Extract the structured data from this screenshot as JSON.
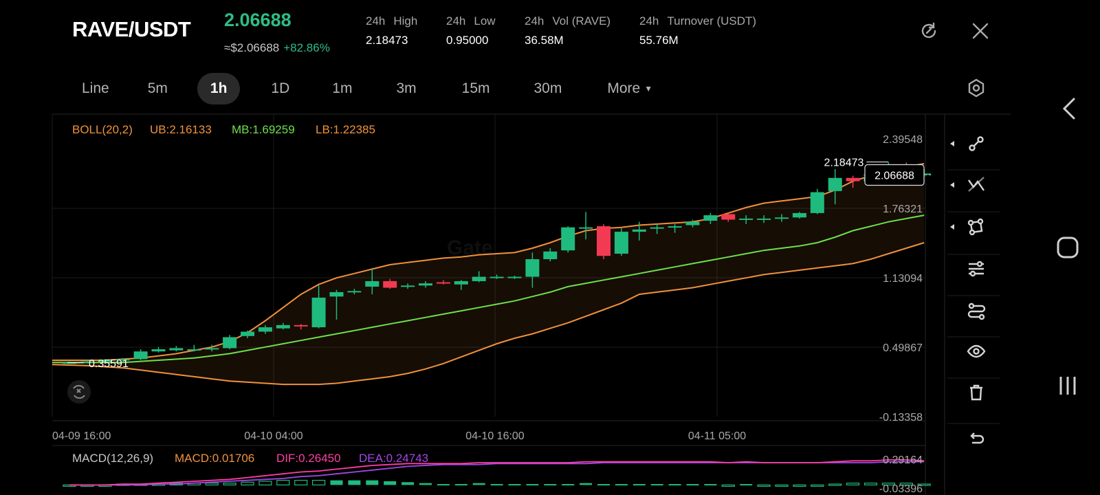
{
  "header": {
    "pair": "RAVE/USDT",
    "price": "2.06688",
    "usd_price": "≈$2.06688",
    "change": "+82.86%",
    "stats": [
      {
        "period": "24h",
        "label": "High",
        "value": "2.18473"
      },
      {
        "period": "24h",
        "label": "Low",
        "value": "0.95000"
      },
      {
        "period": "24h",
        "label": "Vol (RAVE)",
        "value": "36.58M"
      },
      {
        "period": "24h",
        "label": "Turnover (USDT)",
        "value": "55.76M"
      }
    ],
    "icons": {
      "refresh": "refresh-icon",
      "close": "close-icon"
    }
  },
  "tabs": [
    {
      "label": "Line",
      "active": false
    },
    {
      "label": "5m",
      "active": false
    },
    {
      "label": "1h",
      "active": true
    },
    {
      "label": "1D",
      "active": false
    },
    {
      "label": "1m",
      "active": false
    },
    {
      "label": "3m",
      "active": false
    },
    {
      "label": "15m",
      "active": false
    },
    {
      "label": "30m",
      "active": false
    },
    {
      "label": "More",
      "active": false
    }
  ],
  "boll": {
    "label": "BOLL(20,2)",
    "ub": "UB:2.16133",
    "mb": "MB:1.69259",
    "lb": "LB:1.22385"
  },
  "macd": {
    "label": "MACD(12,26,9)",
    "macd": "MACD:0.01706",
    "dif": "DIF:0.26450",
    "dea": "DEA:0.24743"
  },
  "price_axis": [
    "2.39548",
    "1.76321",
    "1.13094",
    "0.49867",
    "-0.13358"
  ],
  "macd_axis": [
    "0.29164",
    "-0.03396"
  ],
  "time_axis": [
    "04-09 16:00",
    "04-10 04:00",
    "04-10 16:00",
    "04-11 05:00"
  ],
  "annotations": {
    "high": "2.18473",
    "low": "0.35591",
    "last": "2.06688"
  },
  "colors": {
    "up": "#1fba7e",
    "down": "#f23a52",
    "ub": "#f0923c",
    "mb": "#6ee04a",
    "lb": "#f0923c",
    "dif": "#ff3fa4",
    "dea": "#a347e8",
    "boll_label": "#f0923c"
  },
  "chart_data": {
    "type": "candlestick",
    "candles": [
      {
        "o": 0.36,
        "c": 0.36,
        "h": 0.37,
        "l": 0.35
      },
      {
        "o": 0.36,
        "c": 0.37,
        "h": 0.38,
        "l": 0.35
      },
      {
        "o": 0.37,
        "c": 0.38,
        "h": 0.39,
        "l": 0.36
      },
      {
        "o": 0.38,
        "c": 0.39,
        "h": 0.4,
        "l": 0.37
      },
      {
        "o": 0.39,
        "c": 0.46,
        "h": 0.48,
        "l": 0.38
      },
      {
        "o": 0.46,
        "c": 0.48,
        "h": 0.5,
        "l": 0.45
      },
      {
        "o": 0.47,
        "c": 0.49,
        "h": 0.51,
        "l": 0.46
      },
      {
        "o": 0.48,
        "c": 0.48,
        "h": 0.52,
        "l": 0.46
      },
      {
        "o": 0.48,
        "c": 0.49,
        "h": 0.52,
        "l": 0.46
      },
      {
        "o": 0.49,
        "c": 0.59,
        "h": 0.61,
        "l": 0.48
      },
      {
        "o": 0.6,
        "c": 0.64,
        "h": 0.65,
        "l": 0.58
      },
      {
        "o": 0.64,
        "c": 0.68,
        "h": 0.7,
        "l": 0.62
      },
      {
        "o": 0.67,
        "c": 0.7,
        "h": 0.72,
        "l": 0.66
      },
      {
        "o": 0.7,
        "c": 0.69,
        "h": 0.71,
        "l": 0.66
      },
      {
        "o": 0.68,
        "c": 0.95,
        "h": 1.06,
        "l": 0.67
      },
      {
        "o": 0.96,
        "c": 1.0,
        "h": 1.02,
        "l": 0.75
      },
      {
        "o": 1.0,
        "c": 1.01,
        "h": 1.03,
        "l": 0.98
      },
      {
        "o": 1.05,
        "c": 1.1,
        "h": 1.22,
        "l": 0.98
      },
      {
        "o": 1.1,
        "c": 1.04,
        "h": 1.12,
        "l": 1.03
      },
      {
        "o": 1.05,
        "c": 1.06,
        "h": 1.08,
        "l": 1.03
      },
      {
        "o": 1.06,
        "c": 1.08,
        "h": 1.1,
        "l": 1.04
      },
      {
        "o": 1.09,
        "c": 1.08,
        "h": 1.11,
        "l": 1.07
      },
      {
        "o": 1.07,
        "c": 1.1,
        "h": 1.11,
        "l": 1.02
      },
      {
        "o": 1.1,
        "c": 1.14,
        "h": 1.19,
        "l": 1.09
      },
      {
        "o": 1.14,
        "c": 1.14,
        "h": 1.16,
        "l": 1.12
      },
      {
        "o": 1.13,
        "c": 1.14,
        "h": 1.15,
        "l": 1.12
      },
      {
        "o": 1.14,
        "c": 1.3,
        "h": 1.36,
        "l": 1.04
      },
      {
        "o": 1.3,
        "c": 1.37,
        "h": 1.4,
        "l": 1.28
      },
      {
        "o": 1.38,
        "c": 1.59,
        "h": 1.6,
        "l": 1.36
      },
      {
        "o": 1.58,
        "c": 1.59,
        "h": 1.73,
        "l": 1.48
      },
      {
        "o": 1.6,
        "c": 1.33,
        "h": 1.62,
        "l": 1.3
      },
      {
        "o": 1.35,
        "c": 1.55,
        "h": 1.58,
        "l": 1.33
      },
      {
        "o": 1.55,
        "c": 1.57,
        "h": 1.64,
        "l": 1.47
      },
      {
        "o": 1.58,
        "c": 1.59,
        "h": 1.62,
        "l": 1.53
      },
      {
        "o": 1.59,
        "c": 1.6,
        "h": 1.62,
        "l": 1.54
      },
      {
        "o": 1.61,
        "c": 1.64,
        "h": 1.66,
        "l": 1.59
      },
      {
        "o": 1.65,
        "c": 1.7,
        "h": 1.72,
        "l": 1.62
      },
      {
        "o": 1.71,
        "c": 1.66,
        "h": 1.72,
        "l": 1.64
      },
      {
        "o": 1.66,
        "c": 1.67,
        "h": 1.7,
        "l": 1.62
      },
      {
        "o": 1.67,
        "c": 1.67,
        "h": 1.7,
        "l": 1.63
      },
      {
        "o": 1.67,
        "c": 1.68,
        "h": 1.71,
        "l": 1.64
      },
      {
        "o": 1.68,
        "c": 1.72,
        "h": 1.73,
        "l": 1.67
      },
      {
        "o": 1.72,
        "c": 1.91,
        "h": 1.94,
        "l": 1.71
      },
      {
        "o": 1.92,
        "c": 2.04,
        "h": 2.12,
        "l": 1.8
      },
      {
        "o": 2.04,
        "c": 2.01,
        "h": 2.06,
        "l": 1.95
      },
      {
        "o": 2.01,
        "c": 2.05,
        "h": 2.06,
        "l": 1.98
      },
      {
        "o": 2.05,
        "c": 2.16,
        "h": 2.18,
        "l": 2.04
      },
      {
        "o": 2.16,
        "c": 2.12,
        "h": 2.18,
        "l": 2.07
      },
      {
        "o": 2.08,
        "c": 2.08,
        "h": 2.12,
        "l": 2.05
      }
    ],
    "ub": [
      0.38,
      0.38,
      0.38,
      0.39,
      0.4,
      0.42,
      0.44,
      0.47,
      0.5,
      0.55,
      0.63,
      0.74,
      0.86,
      0.98,
      1.07,
      1.13,
      1.17,
      1.21,
      1.25,
      1.27,
      1.29,
      1.31,
      1.32,
      1.34,
      1.35,
      1.36,
      1.4,
      1.45,
      1.51,
      1.56,
      1.58,
      1.59,
      1.61,
      1.62,
      1.63,
      1.64,
      1.67,
      1.72,
      1.77,
      1.81,
      1.83,
      1.85,
      1.87,
      1.93,
      2.01,
      2.06,
      2.12,
      2.14,
      2.17
    ],
    "mb": [
      0.36,
      0.36,
      0.36,
      0.36,
      0.37,
      0.38,
      0.39,
      0.4,
      0.42,
      0.44,
      0.47,
      0.5,
      0.53,
      0.56,
      0.59,
      0.62,
      0.65,
      0.68,
      0.71,
      0.74,
      0.77,
      0.8,
      0.83,
      0.86,
      0.89,
      0.92,
      0.96,
      1.0,
      1.05,
      1.08,
      1.11,
      1.14,
      1.17,
      1.2,
      1.23,
      1.26,
      1.29,
      1.32,
      1.35,
      1.38,
      1.4,
      1.42,
      1.45,
      1.5,
      1.56,
      1.6,
      1.64,
      1.67,
      1.7
    ],
    "lb": [
      0.34,
      0.33,
      0.32,
      0.31,
      0.29,
      0.27,
      0.25,
      0.23,
      0.21,
      0.19,
      0.18,
      0.17,
      0.16,
      0.16,
      0.16,
      0.17,
      0.19,
      0.21,
      0.23,
      0.26,
      0.3,
      0.35,
      0.41,
      0.47,
      0.53,
      0.58,
      0.62,
      0.67,
      0.72,
      0.78,
      0.84,
      0.9,
      0.98,
      1.0,
      1.02,
      1.04,
      1.07,
      1.1,
      1.13,
      1.16,
      1.18,
      1.2,
      1.22,
      1.24,
      1.26,
      1.3,
      1.35,
      1.4,
      1.45
    ],
    "dif": [
      0.0,
      0.0,
      0.0,
      0.01,
      0.01,
      0.02,
      0.03,
      0.04,
      0.05,
      0.06,
      0.08,
      0.1,
      0.12,
      0.14,
      0.15,
      0.17,
      0.19,
      0.21,
      0.22,
      0.23,
      0.23,
      0.23,
      0.23,
      0.24,
      0.24,
      0.24,
      0.24,
      0.24,
      0.24,
      0.25,
      0.25,
      0.25,
      0.25,
      0.25,
      0.25,
      0.25,
      0.25,
      0.24,
      0.25,
      0.24,
      0.24,
      0.24,
      0.24,
      0.25,
      0.26,
      0.26,
      0.27,
      0.27,
      0.26
    ],
    "dea": [
      0.0,
      0.0,
      0.0,
      0.0,
      0.0,
      0.01,
      0.01,
      0.02,
      0.03,
      0.04,
      0.05,
      0.06,
      0.07,
      0.09,
      0.1,
      0.12,
      0.14,
      0.16,
      0.18,
      0.2,
      0.21,
      0.22,
      0.22,
      0.22,
      0.23,
      0.23,
      0.23,
      0.23,
      0.23,
      0.23,
      0.24,
      0.24,
      0.24,
      0.24,
      0.24,
      0.24,
      0.24,
      0.24,
      0.24,
      0.24,
      0.24,
      0.24,
      0.24,
      0.24,
      0.24,
      0.24,
      0.25,
      0.25,
      0.25
    ],
    "hist": [
      0.0,
      0.0,
      0.0,
      0.01,
      0.01,
      0.01,
      0.02,
      0.02,
      0.02,
      0.02,
      0.03,
      0.04,
      0.05,
      0.05,
      0.05,
      0.05,
      0.05,
      0.05,
      0.04,
      0.03,
      0.02,
      0.01,
      0.01,
      0.02,
      0.01,
      0.01,
      0.01,
      0.01,
      0.01,
      0.02,
      0.01,
      0.01,
      0.01,
      0.01,
      0.01,
      0.01,
      0.01,
      0.0,
      0.01,
      0.0,
      -0.0,
      -0.0,
      0.0,
      0.01,
      0.02,
      0.02,
      0.02,
      0.02,
      0.01
    ],
    "price_range": [
      -0.13358,
      2.39548
    ],
    "macd_range": [
      -0.03396,
      0.29164
    ]
  }
}
